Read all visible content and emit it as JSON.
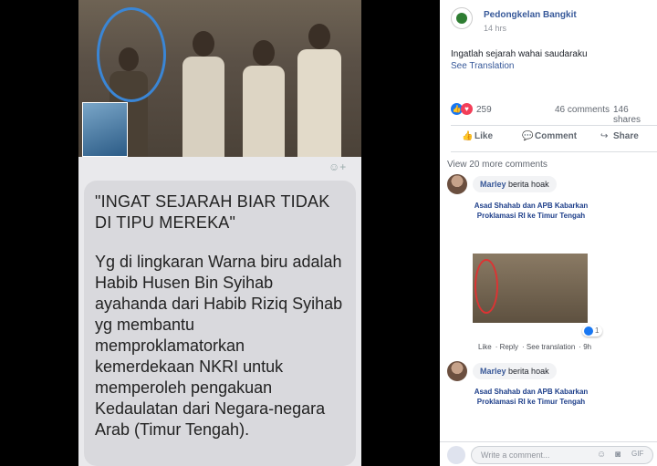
{
  "left_image": {
    "quote": "\"INGAT SEJARAH BIAR TIDAK DI TIPU MEREKA\"",
    "body": "Yg di lingkaran Warna biru adalah Habib Husen Bin Syihab ayahanda dari Habib Riziq Syihab yg membantu memproklamatorkan kemerdekaan NKRI untuk memperoleh pengakuan Kedaulatan dari Negara-negara Arab (Timur Tengah)."
  },
  "post": {
    "page_name": "Pedongkelan Bangkit",
    "time": "14 hrs",
    "text": "Ingatlah sejarah wahai saudaraku",
    "see_translation": "See Translation",
    "reaction_count": "259",
    "comment_count": "46 comments",
    "share_count": "146 shares",
    "actions": {
      "like": "Like",
      "comment": "Comment",
      "share": "Share"
    }
  },
  "comments": {
    "view_more": "View 20 more comments",
    "items": [
      {
        "name": "Marley",
        "text": "berita hoak",
        "news_title": "Asad Shahab dan APB Kabarkan Proklamasi RI ke Timur Tengah",
        "like_count": "1",
        "actions": [
          "Like",
          "Reply",
          "See translation",
          "9h"
        ]
      },
      {
        "name": "Marley",
        "text": "berita hoak",
        "news_title": "Asad Shahab dan APB Kabarkan Proklamasi RI ke Timur Tengah"
      }
    ]
  },
  "composer": {
    "placeholder": "Write a comment..."
  },
  "colors": {
    "link": "#365899",
    "brand_blue": "#1877f2",
    "love_red": "#f33e58",
    "circle_blue": "#3a86d6"
  }
}
